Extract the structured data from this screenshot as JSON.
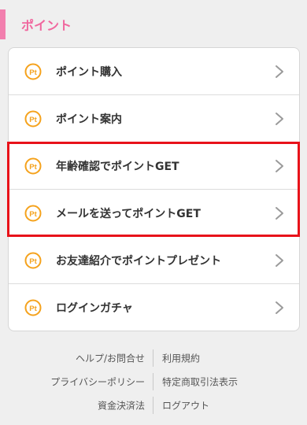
{
  "section": {
    "title": "ポイント"
  },
  "menu": {
    "items": [
      {
        "label": "ポイント購入",
        "icon": "pt-coin-icon"
      },
      {
        "label": "ポイント案内",
        "icon": "pt-coin-icon"
      },
      {
        "label": "年齢確認でポイントGET",
        "icon": "pt-coin-icon"
      },
      {
        "label": "メールを送ってポイントGET",
        "icon": "pt-coin-icon"
      },
      {
        "label": "お友達紹介でポイントプレゼント",
        "icon": "pt-coin-icon"
      },
      {
        "label": "ログインガチャ",
        "icon": "pt-coin-icon"
      }
    ],
    "icon_badge_text": "Pt",
    "icon_color": "#f5a21c",
    "highlight_color": "#e8121a"
  },
  "footer": {
    "rows": [
      {
        "left": "ヘルプ/お問合せ",
        "right": "利用規約"
      },
      {
        "left": "プライバシーポリシー",
        "right": "特定商取引法表示"
      },
      {
        "left": "資金決済法",
        "right": "ログアウト"
      }
    ]
  },
  "colors": {
    "accent_pink": "#f0679e",
    "background": "#efefef"
  }
}
